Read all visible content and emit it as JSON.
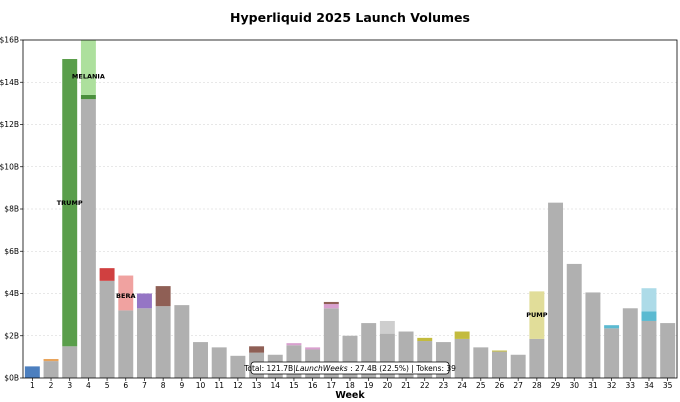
{
  "chart_data": {
    "type": "bar",
    "stacked": true,
    "title": "Hyperliquid 2025 Launch Volumes",
    "xlabel": "Week",
    "ylabel": "",
    "ylim": [
      0,
      16
    ],
    "y_unit": "B",
    "yticks": [
      0,
      2,
      4,
      6,
      8,
      10,
      12,
      14,
      16
    ],
    "ytick_labels": [
      "$0B",
      "$2B",
      "$4B",
      "$6B",
      "$8B",
      "$10B",
      "$12B",
      "$14B",
      "$16B"
    ],
    "grid": "horizontal dotted",
    "categories": [
      "1",
      "2",
      "3",
      "4",
      "5",
      "6",
      "7",
      "8",
      "9",
      "10",
      "11",
      "12",
      "13",
      "14",
      "15",
      "16",
      "17",
      "18",
      "19",
      "20",
      "21",
      "22",
      "23",
      "24",
      "25",
      "26",
      "27",
      "28",
      "29",
      "30",
      "31",
      "32",
      "33",
      "34",
      "35"
    ],
    "base_color": "#b0b0b0",
    "base_values": [
      0.0,
      0.8,
      1.5,
      13.2,
      4.6,
      3.2,
      3.3,
      3.4,
      3.45,
      1.7,
      1.45,
      1.05,
      1.2,
      1.1,
      1.55,
      1.35,
      3.3,
      2.0,
      2.6,
      2.1,
      2.2,
      1.75,
      1.7,
      1.85,
      1.45,
      1.25,
      1.1,
      1.85,
      8.3,
      5.4,
      4.05,
      2.35,
      3.3,
      2.7,
      2.6
    ],
    "token_segments": [
      {
        "week": "1",
        "value": 0.55,
        "color": "#4c7fbf"
      },
      {
        "week": "2",
        "value": 0.1,
        "color": "#e8a45c"
      },
      {
        "week": "3",
        "value": 13.6,
        "color": "#5a9e4b"
      },
      {
        "week": "4",
        "value": 0.2,
        "color": "#4a8f3c"
      },
      {
        "week": "4",
        "value": 2.6,
        "color": "#ade09d"
      },
      {
        "week": "5",
        "value": 0.6,
        "color": "#d04040"
      },
      {
        "week": "6",
        "value": 1.65,
        "color": "#f0a2a0"
      },
      {
        "week": "7",
        "value": 0.7,
        "color": "#9575c5"
      },
      {
        "week": "8",
        "value": 0.95,
        "color": "#8f5f55"
      },
      {
        "week": "13",
        "value": 0.3,
        "color": "#8f5f55"
      },
      {
        "week": "15",
        "value": 0.1,
        "color": "#d9a0cf"
      },
      {
        "week": "16",
        "value": 0.1,
        "color": "#d9a0cf"
      },
      {
        "week": "17",
        "value": 0.2,
        "color": "#d9a0cf"
      },
      {
        "week": "17",
        "value": 0.1,
        "color": "#8f5f55"
      },
      {
        "week": "20",
        "value": 0.6,
        "color": "#cecece"
      },
      {
        "week": "22",
        "value": 0.15,
        "color": "#c3bb3e"
      },
      {
        "week": "24",
        "value": 0.35,
        "color": "#c3bb3e"
      },
      {
        "week": "26",
        "value": 0.05,
        "color": "#c3bb3e"
      },
      {
        "week": "28",
        "value": 2.25,
        "color": "#e1dd99"
      },
      {
        "week": "32",
        "value": 0.15,
        "color": "#5bbad1"
      },
      {
        "week": "34",
        "value": 0.45,
        "color": "#5bbad1"
      },
      {
        "week": "34",
        "value": 1.1,
        "color": "#addbe8"
      }
    ],
    "annotations": [
      {
        "text": "TRUMP",
        "week": "3",
        "y": 8.3
      },
      {
        "text": "MELANIA",
        "week": "4",
        "y": 14.3
      },
      {
        "text": "BERA",
        "week": "6",
        "y": 3.9
      },
      {
        "text": "PUMP",
        "week": "28",
        "y": 3.0
      }
    ],
    "summary": "Total: 121.7B|LaunchWeeks : 27.4B (22.5%) | Tokens: 39",
    "summary_italic_word": "LaunchWeeks"
  }
}
